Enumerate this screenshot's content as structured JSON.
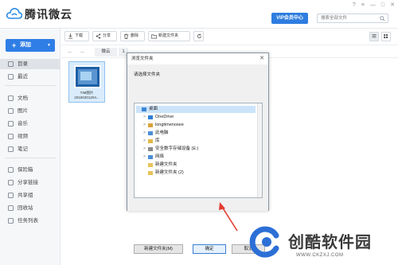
{
  "app": {
    "name": "腾讯微云"
  },
  "header": {
    "vip_label": "VIP会员中心",
    "search_placeholder": "搜索全部文件",
    "window_controls": [
      "?",
      "≡",
      "—",
      "□",
      "✕"
    ]
  },
  "sidebar": {
    "add_label": "添加",
    "groups": [
      [
        {
          "label": "目录",
          "icon": "folder-icon",
          "active": true
        },
        {
          "label": "最近",
          "icon": "clock-icon"
        }
      ],
      [
        {
          "label": "文档",
          "icon": "document-icon"
        },
        {
          "label": "图片",
          "icon": "image-icon"
        },
        {
          "label": "音乐",
          "icon": "music-icon"
        },
        {
          "label": "视频",
          "icon": "video-icon"
        },
        {
          "label": "笔记",
          "icon": "note-icon"
        }
      ],
      [
        {
          "label": "保险箱",
          "icon": "safe-icon"
        },
        {
          "label": "分享链接",
          "icon": "share-link-icon"
        },
        {
          "label": "共享组",
          "icon": "group-icon"
        },
        {
          "label": "回收站",
          "icon": "trash-icon"
        },
        {
          "label": "任务列表",
          "icon": "task-list-icon"
        }
      ]
    ]
  },
  "toolbar": {
    "download": "下载",
    "share": "分享",
    "delete": "删除",
    "new_folder": "新建文件夹"
  },
  "path": {
    "crumb": "微云",
    "count": "1"
  },
  "file": {
    "name_line1": "TIM图片",
    "name_line2": "20180301204..."
  },
  "dialog": {
    "title": "浏览文件夹",
    "prompt": "请选择文件夹",
    "tree": [
      {
        "label": "桌面",
        "icon": "desktop-icon",
        "level": 0,
        "selected": true,
        "expander": ""
      },
      {
        "label": "OneDrive",
        "icon": "cloud-icon",
        "level": 1,
        "expander": ">"
      },
      {
        "label": "longtimenosee",
        "icon": "user-icon",
        "level": 1,
        "expander": ">"
      },
      {
        "label": "此电脑",
        "icon": "computer-icon",
        "level": 1,
        "expander": ">"
      },
      {
        "label": "库",
        "icon": "library-icon",
        "level": 1,
        "expander": ">"
      },
      {
        "label": "安全数字存储设备 (E:)",
        "icon": "drive-icon",
        "level": 1,
        "expander": ">"
      },
      {
        "label": "网络",
        "icon": "network-icon",
        "level": 1,
        "expander": ">"
      },
      {
        "label": "新建文件夹",
        "icon": "folder-icon",
        "level": 1,
        "expander": ""
      },
      {
        "label": "新建文件夹 (2)",
        "icon": "folder-icon",
        "level": 1,
        "expander": ""
      }
    ],
    "new_folder_btn": "新建文件夹(M)",
    "ok_btn": "确定",
    "cancel_btn": "取消"
  },
  "watermark": {
    "text": "创酷软件园",
    "url": "WWW.CKZXJ.COM"
  },
  "colors": {
    "accent": "#2f7ee6",
    "vip": "#2e7de0",
    "arrow": "#e23b2f"
  }
}
